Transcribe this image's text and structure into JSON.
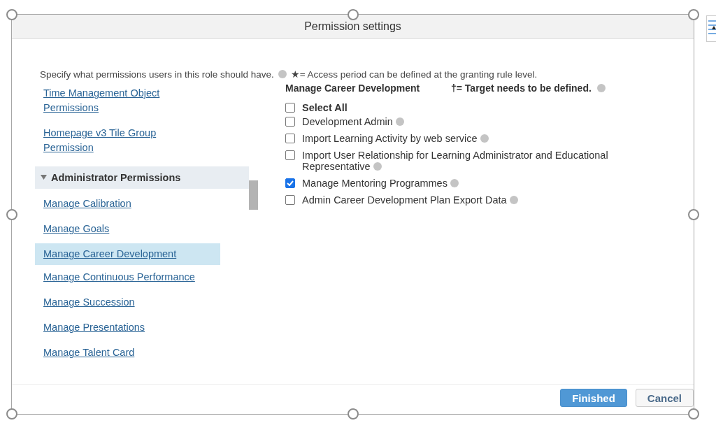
{
  "dialog": {
    "title": "Permission settings",
    "instruction": "Specify what permissions users in this role should have.",
    "legend": "★= Access period can be defined at the granting rule level.",
    "sidebar": {
      "items": [
        {
          "label": "Time Management Object Permissions",
          "selected": false
        },
        {
          "label": "Homepage v3 Tile Group Permission",
          "selected": false
        }
      ],
      "section": {
        "label": "Administrator Permissions",
        "expanded": true,
        "items": [
          {
            "label": "Manage Calibration",
            "selected": false
          },
          {
            "label": "Manage Goals",
            "selected": false
          },
          {
            "label": "Manage Career Development",
            "selected": true
          },
          {
            "label": "Manage Continuous Performance",
            "selected": false
          },
          {
            "label": "Manage Succession",
            "selected": false
          },
          {
            "label": "Manage Presentations",
            "selected": false
          },
          {
            "label": "Manage Talent Card",
            "selected": false
          }
        ]
      }
    },
    "panel": {
      "heading": "Manage Career Development",
      "legend": "†= Target needs to be defined.",
      "options": [
        {
          "kind": "select_all",
          "label": "Select All",
          "checked": false
        },
        {
          "kind": "permission",
          "label": "Development Admin",
          "checked": false
        },
        {
          "kind": "permission",
          "label": "Import Learning Activity by web service",
          "checked": false
        },
        {
          "kind": "permission",
          "label": "Import User Relationship for Learning Administrator and Educational Representative",
          "checked": false
        },
        {
          "kind": "permission",
          "label": "Manage Mentoring Programmes",
          "checked": true
        },
        {
          "kind": "permission",
          "label": "Admin Career Development Plan Export Data",
          "checked": false
        }
      ]
    },
    "buttons": [
      {
        "kind": "primary",
        "label": "Finished"
      },
      {
        "kind": "secondary",
        "label": "Cancel"
      }
    ]
  }
}
